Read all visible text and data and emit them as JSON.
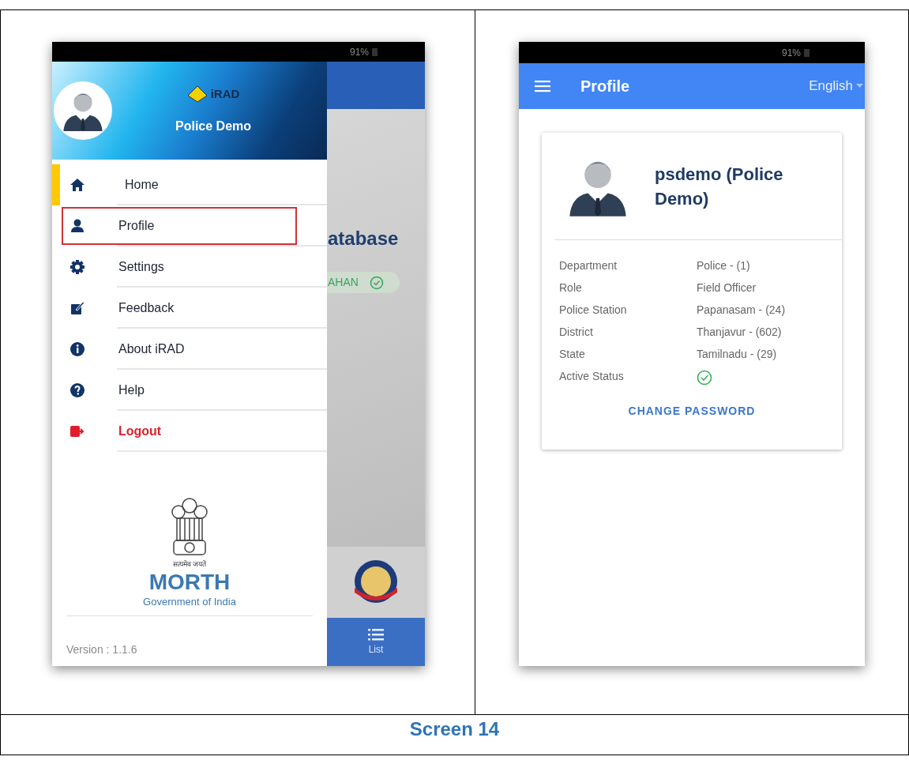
{
  "left_screen": {
    "status_bar": {
      "battery": "91%"
    },
    "drawer": {
      "app_name": "iRAD",
      "user_name": "Police Demo",
      "items": [
        {
          "label": "Home",
          "kind": "normal",
          "selected": true,
          "highlighted": false
        },
        {
          "label": "Profile",
          "kind": "normal",
          "selected": false,
          "highlighted": true
        },
        {
          "label": "Settings",
          "kind": "normal",
          "selected": false,
          "highlighted": false
        },
        {
          "label": "Feedback",
          "kind": "normal",
          "selected": false,
          "highlighted": false
        },
        {
          "label": "About iRAD",
          "kind": "normal",
          "selected": false,
          "highlighted": false
        },
        {
          "label": "Help",
          "kind": "normal",
          "selected": false,
          "highlighted": false
        },
        {
          "label": "Logout",
          "kind": "danger",
          "selected": false,
          "highlighted": false
        }
      ],
      "emblem_motto": "सत्यमेव जयते",
      "org": "MORTH",
      "org_sub": "Government of India",
      "version": "Version : 1.1.6"
    },
    "background": {
      "heading": "atabase",
      "chip": "AHAN",
      "bottom_tab": "List"
    }
  },
  "right_screen": {
    "status_bar": {
      "battery": "91%"
    },
    "app_bar": {
      "title": "Profile",
      "language": "English"
    },
    "card": {
      "name": "psdemo (Police Demo)",
      "fields": [
        {
          "label": "Department",
          "value": "Police - (1)"
        },
        {
          "label": "Role",
          "value": "Field Officer"
        },
        {
          "label": "Police Station",
          "value": "Papanasam - (24)"
        },
        {
          "label": "District",
          "value": "Thanjavur - (602)"
        },
        {
          "label": "State",
          "value": "Tamilnadu - (29)"
        }
      ],
      "active_label": "Active Status",
      "active": true,
      "button": "CHANGE PASSWORD"
    }
  },
  "caption": "Screen 14"
}
